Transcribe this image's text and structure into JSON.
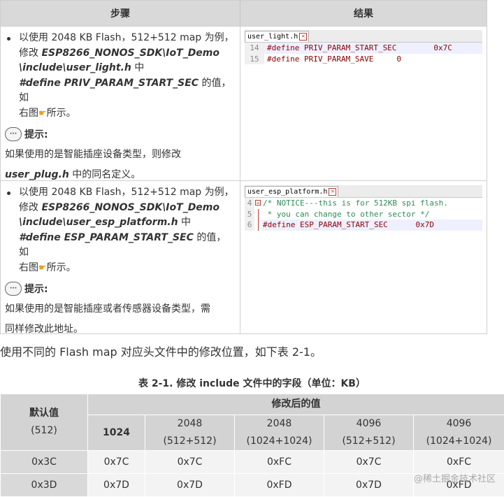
{
  "steps_table": {
    "header": {
      "step": "步骤",
      "result": "结果"
    },
    "rows": [
      {
        "line1": "以使用 2048 KB Flash，512+512 map 为例，",
        "line2_prefix": "修改 ",
        "path1": "ESP8266_NONOS_SDK\\IoT_Demo",
        "path2": "\\include\\user_light.h",
        "path2_suffix": " 中",
        "define": "#define PRIV_PARAM_START_SEC",
        "define_suffix": " 的值，如",
        "line5_prefix": "右图",
        "line5_suffix": "所示。",
        "tip_label": "提示:",
        "tip_line1": "如果使用的是智能插座设备类型，则修改",
        "tip_file": "user_plug.h",
        "tip_line2_suffix": " 中的同名定义。",
        "code": {
          "tab": "user_light.h",
          "lines": [
            {
              "num": "14",
              "text": "#define PRIV_PARAM_START_SEC        0x7C"
            },
            {
              "num": "15",
              "text": "#define PRIV_PARAM_SAVE     0"
            }
          ]
        }
      },
      {
        "line1": "以使用 2048 KB Flash，512+512 map 为例，",
        "line2_prefix": "修改 ",
        "path1": "ESP8266_NONOS_SDK\\IoT_Demo",
        "path2": "\\include\\user_esp_platform.h",
        "path2_suffix": " 中",
        "define": "#define ESP_PARAM_START_SEC",
        "define_suffix": " 的值，如",
        "line5_prefix": "右图",
        "line5_suffix": "所示。",
        "tip_label": "提示:",
        "tip_line1": "如果使用的是智能插座或者传感器设备类型，需",
        "tip_line2": "同样修改此地址。",
        "code": {
          "tab": "user_esp_platform.h",
          "lines": [
            {
              "num": "4",
              "text": "/* NOTICE---this is for 512KB spi flash."
            },
            {
              "num": "5",
              "text": " * you can change to other sector */"
            },
            {
              "num": "6",
              "text": "#define ESP_PARAM_START_SEC      0x7D"
            }
          ]
        }
      }
    ]
  },
  "paragraph": "使用不同的 Flash map 对应头文件中的修改位置，如下表 2-1。",
  "caption": "表 2-1. 修改 include 文件中的字段（单位：KB）",
  "map_table": {
    "default_header": "默认值",
    "default_sub": "(512)",
    "modified_header": "修改后的值",
    "columns": [
      {
        "line1": "1024",
        "line2": ""
      },
      {
        "line1": "2048",
        "line2": "(512+512)"
      },
      {
        "line1": "2048",
        "line2": "(1024+1024)"
      },
      {
        "line1": "4096",
        "line2": "(512+512)"
      },
      {
        "line1": "4096",
        "line2": "(1024+1024)"
      }
    ],
    "rows": [
      [
        "0x3C",
        "0x7C",
        "0x7C",
        "0xFC",
        "0x7C",
        "0xFC"
      ],
      [
        "0x3D",
        "0x7D",
        "0x7D",
        "0xFD",
        "0x7D",
        "0xFD"
      ]
    ]
  },
  "watermark": "@稀土掘金技术社区",
  "icons": {
    "hand": "pointing-hand-icon",
    "tip": "speech-bubble-icon"
  }
}
